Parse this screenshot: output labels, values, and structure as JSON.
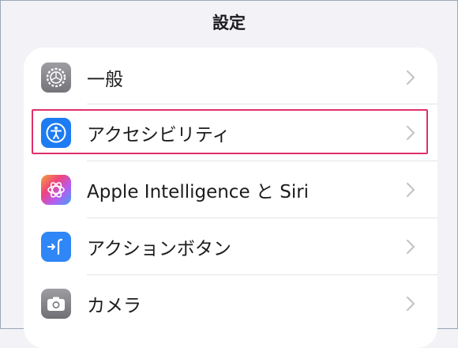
{
  "header": {
    "title": "設定"
  },
  "settings": {
    "items": [
      {
        "label": "一般",
        "icon": "gear-icon",
        "icon_color": "#8e8e93"
      },
      {
        "label": "アクセシビリティ",
        "icon": "accessibility-icon",
        "icon_color": "#1d7cf2"
      },
      {
        "label": "Apple Intelligence と Siri",
        "icon": "apple-intelligence-icon",
        "icon_color": "#b65cf0"
      },
      {
        "label": "アクションボタン",
        "icon": "action-button-icon",
        "icon_color": "#2f86f6"
      },
      {
        "label": "カメラ",
        "icon": "camera-icon",
        "icon_color": "#8e8e93"
      }
    ]
  },
  "highlight_color": "#e0306a"
}
